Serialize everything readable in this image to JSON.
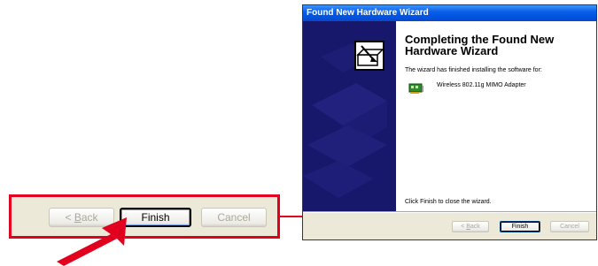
{
  "window": {
    "title": "Found New Hardware Wizard",
    "heading_line1": "Completing the Found New",
    "heading_line2": "Hardware Wizard",
    "installed_message": "The wizard has finished installing the software for:",
    "device_name": "Wireless 802.11g MIMO Adapter",
    "finish_message": "Click Finish to close the wizard.",
    "buttons": {
      "back_prefix": "< ",
      "back_accel": "B",
      "back_rest": "ack",
      "finish": "Finish",
      "cancel": "Cancel"
    }
  },
  "zoom": {
    "back_prefix": "< ",
    "back_accel": "B",
    "back_rest": "ack",
    "finish": "Finish",
    "cancel": "Cancel"
  },
  "colors": {
    "annotation_red": "#e1001e",
    "title_blue": "#0054e3",
    "sidebar_navy": "#17176b",
    "dialog_face": "#ece9d8"
  },
  "icons": [
    "wizard-hardware-icon",
    "network-card-icon",
    "red-pointer-arrow-icon",
    "red-connector-arrow-icon"
  ]
}
